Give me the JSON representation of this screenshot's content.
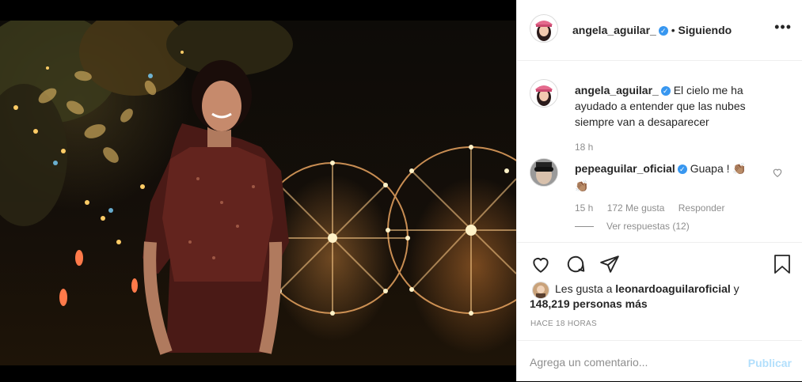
{
  "post": {
    "author": "angela_aguilar_",
    "follow_status": "Siguiendo",
    "caption": "El cielo me ha ayudado a entender que las nubes siempre van a desaparecer",
    "caption_time": "18 h"
  },
  "comment": {
    "author": "pepeaguilar_oficial",
    "text": "Guapa ! 👏🏽",
    "text_line2": "👏🏽",
    "time": "15 h",
    "likes": "172 Me gusta",
    "reply_label": "Responder",
    "view_replies": "Ver respuestas (12)"
  },
  "likes": {
    "prefix": "Les gusta a",
    "user": "leonardoaguilaroficial",
    "conjunction": "y",
    "others": "148,219 personas más"
  },
  "timestamp": "HACE 18 HORAS",
  "add_comment": {
    "placeholder": "Agrega un comentario...",
    "publish_label": "Publicar"
  },
  "colors": {
    "accent": "#3897f0",
    "publish_disabled": "#b2dffc",
    "muted": "#8e8e8e",
    "text": "#262626"
  },
  "icons": [
    "more-options-icon",
    "heart-icon",
    "comment-icon",
    "share-icon",
    "bookmark-icon",
    "verified-icon",
    "comment-heart-icon"
  ]
}
